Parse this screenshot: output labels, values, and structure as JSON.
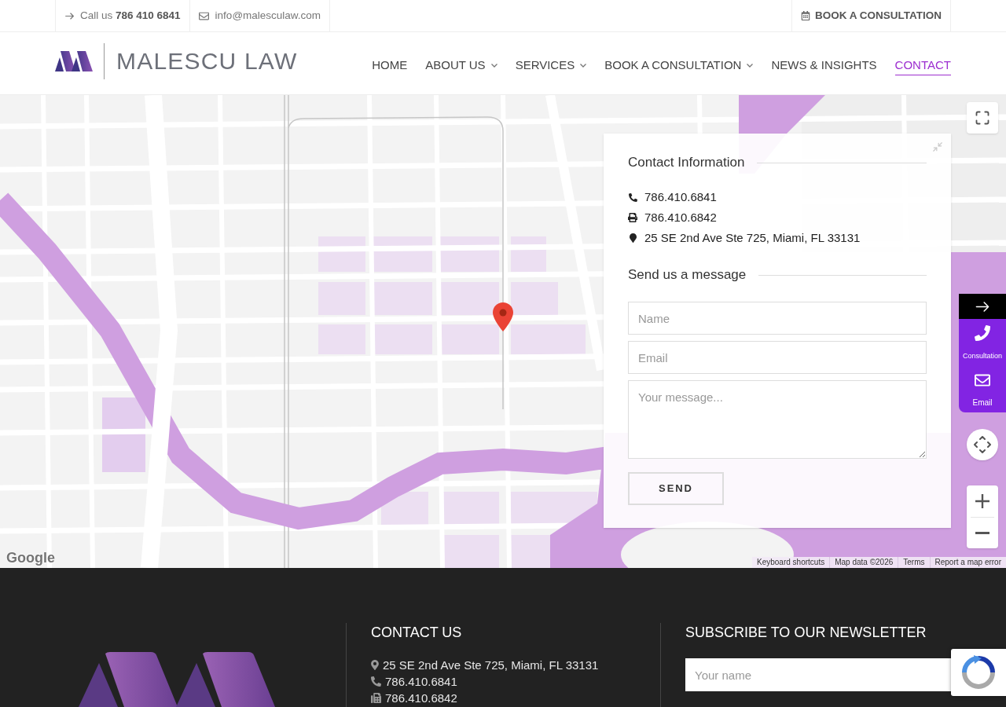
{
  "top_bar": {
    "call_link": "Call us **786 410 6841**",
    "email_link": "info@malesculaw.com",
    "book_link": "BOOK A CONSULTATION"
  },
  "header": {
    "logo_text": "MALESCU LAW",
    "nav": [
      {
        "label": "HOME",
        "dropdown": false,
        "selected": false
      },
      {
        "label": "ABOUT US",
        "dropdown": true,
        "selected": false
      },
      {
        "label": "SERVICES",
        "dropdown": true,
        "selected": false
      },
      {
        "label": "BOOK A CONSULTATION",
        "dropdown": true,
        "selected": false
      },
      {
        "label": "NEWS & INSIGHTS",
        "dropdown": false,
        "selected": false
      },
      {
        "label": "CONTACT",
        "dropdown": false,
        "selected": true
      }
    ]
  },
  "map": {
    "contact_panel": {
      "title": "Contact Information",
      "details": [
        {
          "kind": "phone",
          "text": "786.410.6841"
        },
        {
          "kind": "fax",
          "text": "786.410.6842"
        },
        {
          "kind": "address",
          "text": "25 SE 2nd Ave Ste 725, Miami, FL 33131"
        }
      ],
      "form_title": "Send us a message",
      "fields": [
        {
          "kind": "input",
          "placeholder": "Name"
        },
        {
          "kind": "input",
          "placeholder": "Email"
        },
        {
          "kind": "textarea",
          "placeholder": "Your message..."
        }
      ],
      "button": "SEND"
    },
    "quick_contact": [
      {
        "kind": "phone",
        "label": "Consultation"
      },
      {
        "kind": "email",
        "label": "Email"
      }
    ],
    "google_logo": "Google",
    "attribution": [
      "Keyboard shortcuts",
      "Map data ©2026",
      "Terms",
      "Report a map error"
    ]
  },
  "footer": {
    "contact": {
      "title": "CONTACT US",
      "details": [
        {
          "kind": "address",
          "text": "25 SE 2nd Ave Ste 725, Miami, FL 33131"
        },
        {
          "kind": "phone",
          "text": "786.410.6841"
        },
        {
          "kind": "fax",
          "text": "786.410.6842"
        }
      ]
    },
    "newsletter": {
      "title": "SUBSCRIBE TO OUR NEWSLETTER",
      "fields": [
        {
          "placeholder": "Your name"
        }
      ]
    }
  }
}
